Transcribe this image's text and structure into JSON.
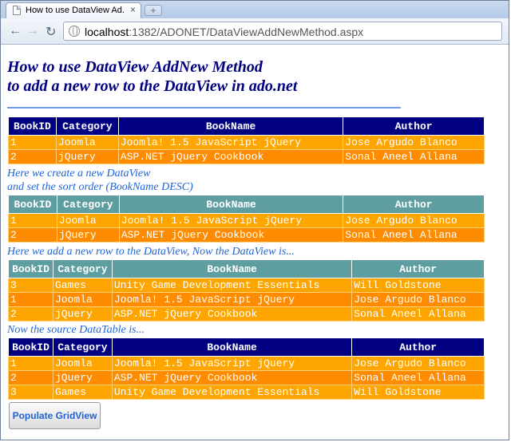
{
  "browser": {
    "tab_title": "How to use DataView Ad...",
    "tab_close": "×",
    "new_tab": "+",
    "url_host": "localhost",
    "url_rest": ":1382/ADONET/DataViewAddNewMethod.aspx"
  },
  "page": {
    "title_line1": "How to use DataView AddNew Method",
    "title_line2": "to add a new row to the DataView in ado.net"
  },
  "columns": [
    "BookID",
    "Category",
    "BookName",
    "Author"
  ],
  "grid1": {
    "rows": [
      [
        "1",
        "Joomla",
        "Joomla! 1.5 JavaScript jQuery",
        "Jose Argudo Blanco"
      ],
      [
        "2",
        "jQuery",
        "ASP.NET jQuery Cookbook",
        "Sonal Aneel Allana"
      ]
    ]
  },
  "note1": {
    "line1": "Here we create a new DataView",
    "line2": "and set the sort order (BookName DESC)"
  },
  "grid2": {
    "rows": [
      [
        "1",
        "Joomla",
        "Joomla! 1.5 JavaScript jQuery",
        "Jose Argudo Blanco"
      ],
      [
        "2",
        "jQuery",
        "ASP.NET jQuery Cookbook",
        "Sonal Aneel Allana"
      ]
    ]
  },
  "note2": "Here we add a new row to the DataView, Now the DataView is...",
  "grid3": {
    "rows": [
      [
        "3",
        "Games",
        "Unity Game Development Essentials",
        "Will Goldstone"
      ],
      [
        "1",
        "Joomla",
        "Joomla! 1.5 JavaScript jQuery",
        "Jose Argudo Blanco"
      ],
      [
        "2",
        "jQuery",
        "ASP.NET jQuery Cookbook",
        "Sonal Aneel Allana"
      ]
    ]
  },
  "note3": "Now the source DataTable is...",
  "grid4": {
    "rows": [
      [
        "1",
        "Joomla",
        "Joomla! 1.5 JavaScript jQuery",
        "Jose Argudo Blanco"
      ],
      [
        "2",
        "jQuery",
        "ASP.NET jQuery Cookbook",
        "Sonal Aneel Allana"
      ],
      [
        "3",
        "Games",
        "Unity Game Development Essentials",
        "Will Goldstone"
      ]
    ]
  },
  "button_label": "Populate GridView",
  "colors": {
    "header_navy": "#000080",
    "header_teal": "#5f9ea0",
    "row_orange": "#ffa500",
    "row_dark_orange": "#ff8c00",
    "note_blue": "#1e63d8"
  }
}
